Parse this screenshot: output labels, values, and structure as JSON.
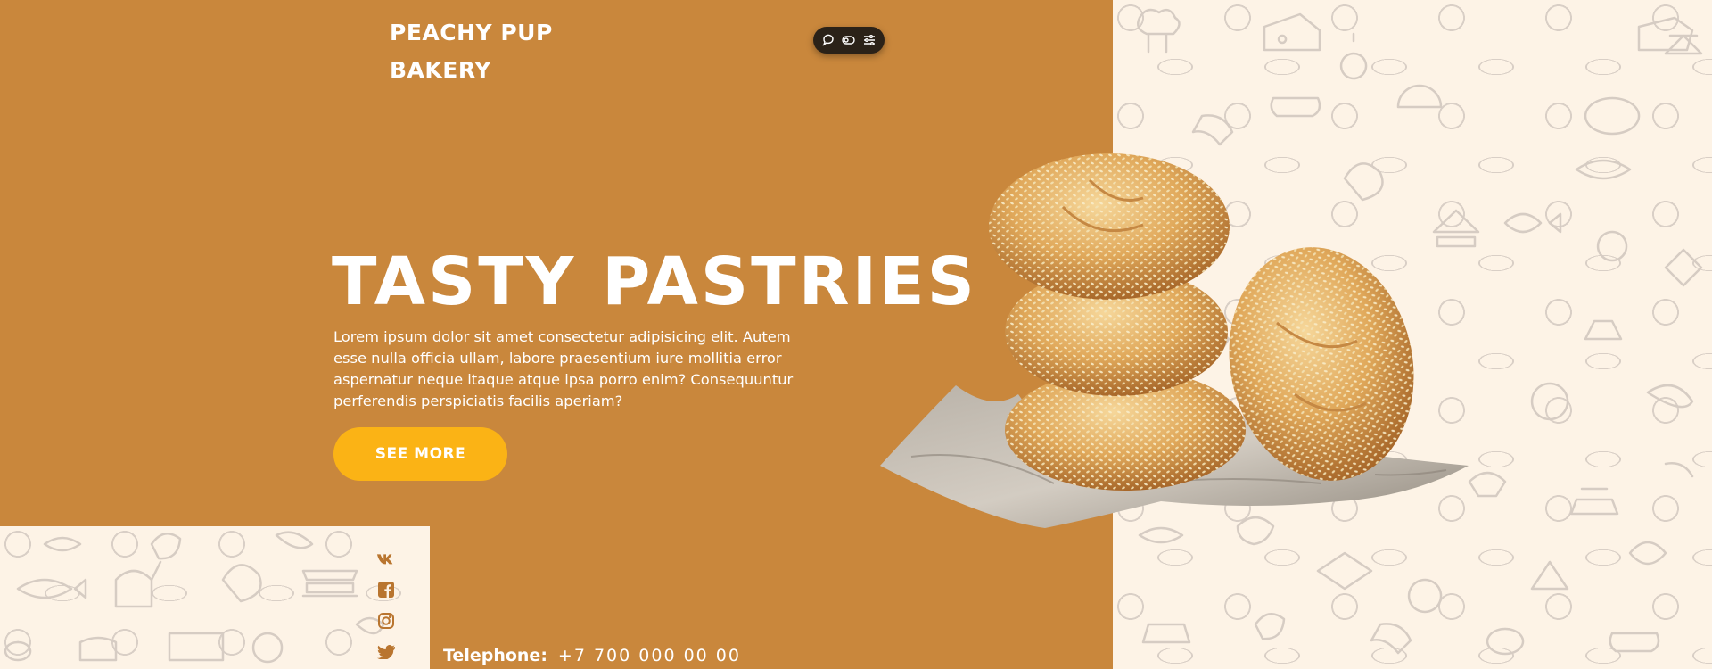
{
  "brand": {
    "line1": "PEACHY PUP",
    "line2": "BAKERY"
  },
  "toolbar": {
    "icons": [
      "chat-icon",
      "toggle-icon",
      "settings-sliders-icon"
    ]
  },
  "hero": {
    "title": "TASTY PASTRIES",
    "description": "Lorem ipsum dolor sit amet consectetur adipisicing elit. Autem esse nulla officia ullam, labore praesentium iure mollitia error aspernatur neque itaque atque ipsa porro enim? Consequuntur perferendis perspiciatis facilis aperiam?",
    "cta_label": "SEE MORE"
  },
  "socials": [
    "vk-icon",
    "facebook-icon",
    "instagram-icon",
    "twitter-icon"
  ],
  "contact": {
    "phone_label": "Telephone:",
    "phone_value": "+7 700 000 00 00"
  },
  "colors": {
    "panel": "#c9873c",
    "cta": "#fbb315",
    "pattern_bg": "#fdf3e6",
    "pattern_line": "#d9cfc6",
    "text": "#ffffff"
  }
}
